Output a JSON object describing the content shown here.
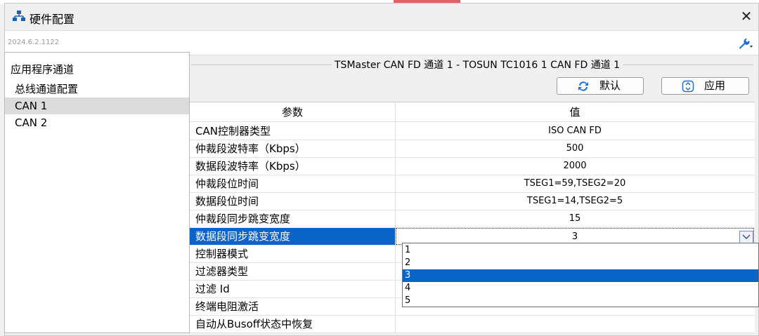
{
  "window": {
    "title": "硬件配置",
    "version": "2024.6.2.1122",
    "close_label": "✕"
  },
  "tree": {
    "items": [
      {
        "label": "应用程序通道"
      },
      {
        "label": "总线通道配置"
      },
      {
        "label": "CAN 1"
      },
      {
        "label": "CAN 2"
      }
    ]
  },
  "panel": {
    "group_title": "TSMaster CAN FD 通道 1 - TOSUN TC1016 1 CAN FD 通道 1",
    "default_button": "默认",
    "apply_button": "应用"
  },
  "grid": {
    "header_param": "参数",
    "header_value": "值",
    "rows": [
      {
        "param": "CAN控制器类型",
        "value": "ISO CAN FD"
      },
      {
        "param": "仲裁段波特率（Kbps）",
        "value": "500"
      },
      {
        "param": "数据段波特率（Kbps）",
        "value": "2000"
      },
      {
        "param": "仲裁段位时间",
        "value": "TSEG1=59,TSEG2=20"
      },
      {
        "param": "数据段位时间",
        "value": "TSEG1=14,TSEG2=5"
      },
      {
        "param": "仲裁段同步跳变宽度",
        "value": "15"
      },
      {
        "param": "数据段同步跳变宽度",
        "value": "3"
      },
      {
        "param": "控制器模式",
        "value": ""
      },
      {
        "param": "过滤器类型",
        "value": ""
      },
      {
        "param": "过滤 Id",
        "value": ""
      },
      {
        "param": "终端电阻激活",
        "value": ""
      },
      {
        "param": "自动从Busoff状态中恢复",
        "value": ""
      }
    ]
  },
  "dropdown": {
    "options": [
      "1",
      "2",
      "3",
      "4",
      "5"
    ],
    "selected": "3"
  },
  "colors": {
    "selection": "#0a64c8",
    "checkbox": "#1f6fd0"
  }
}
